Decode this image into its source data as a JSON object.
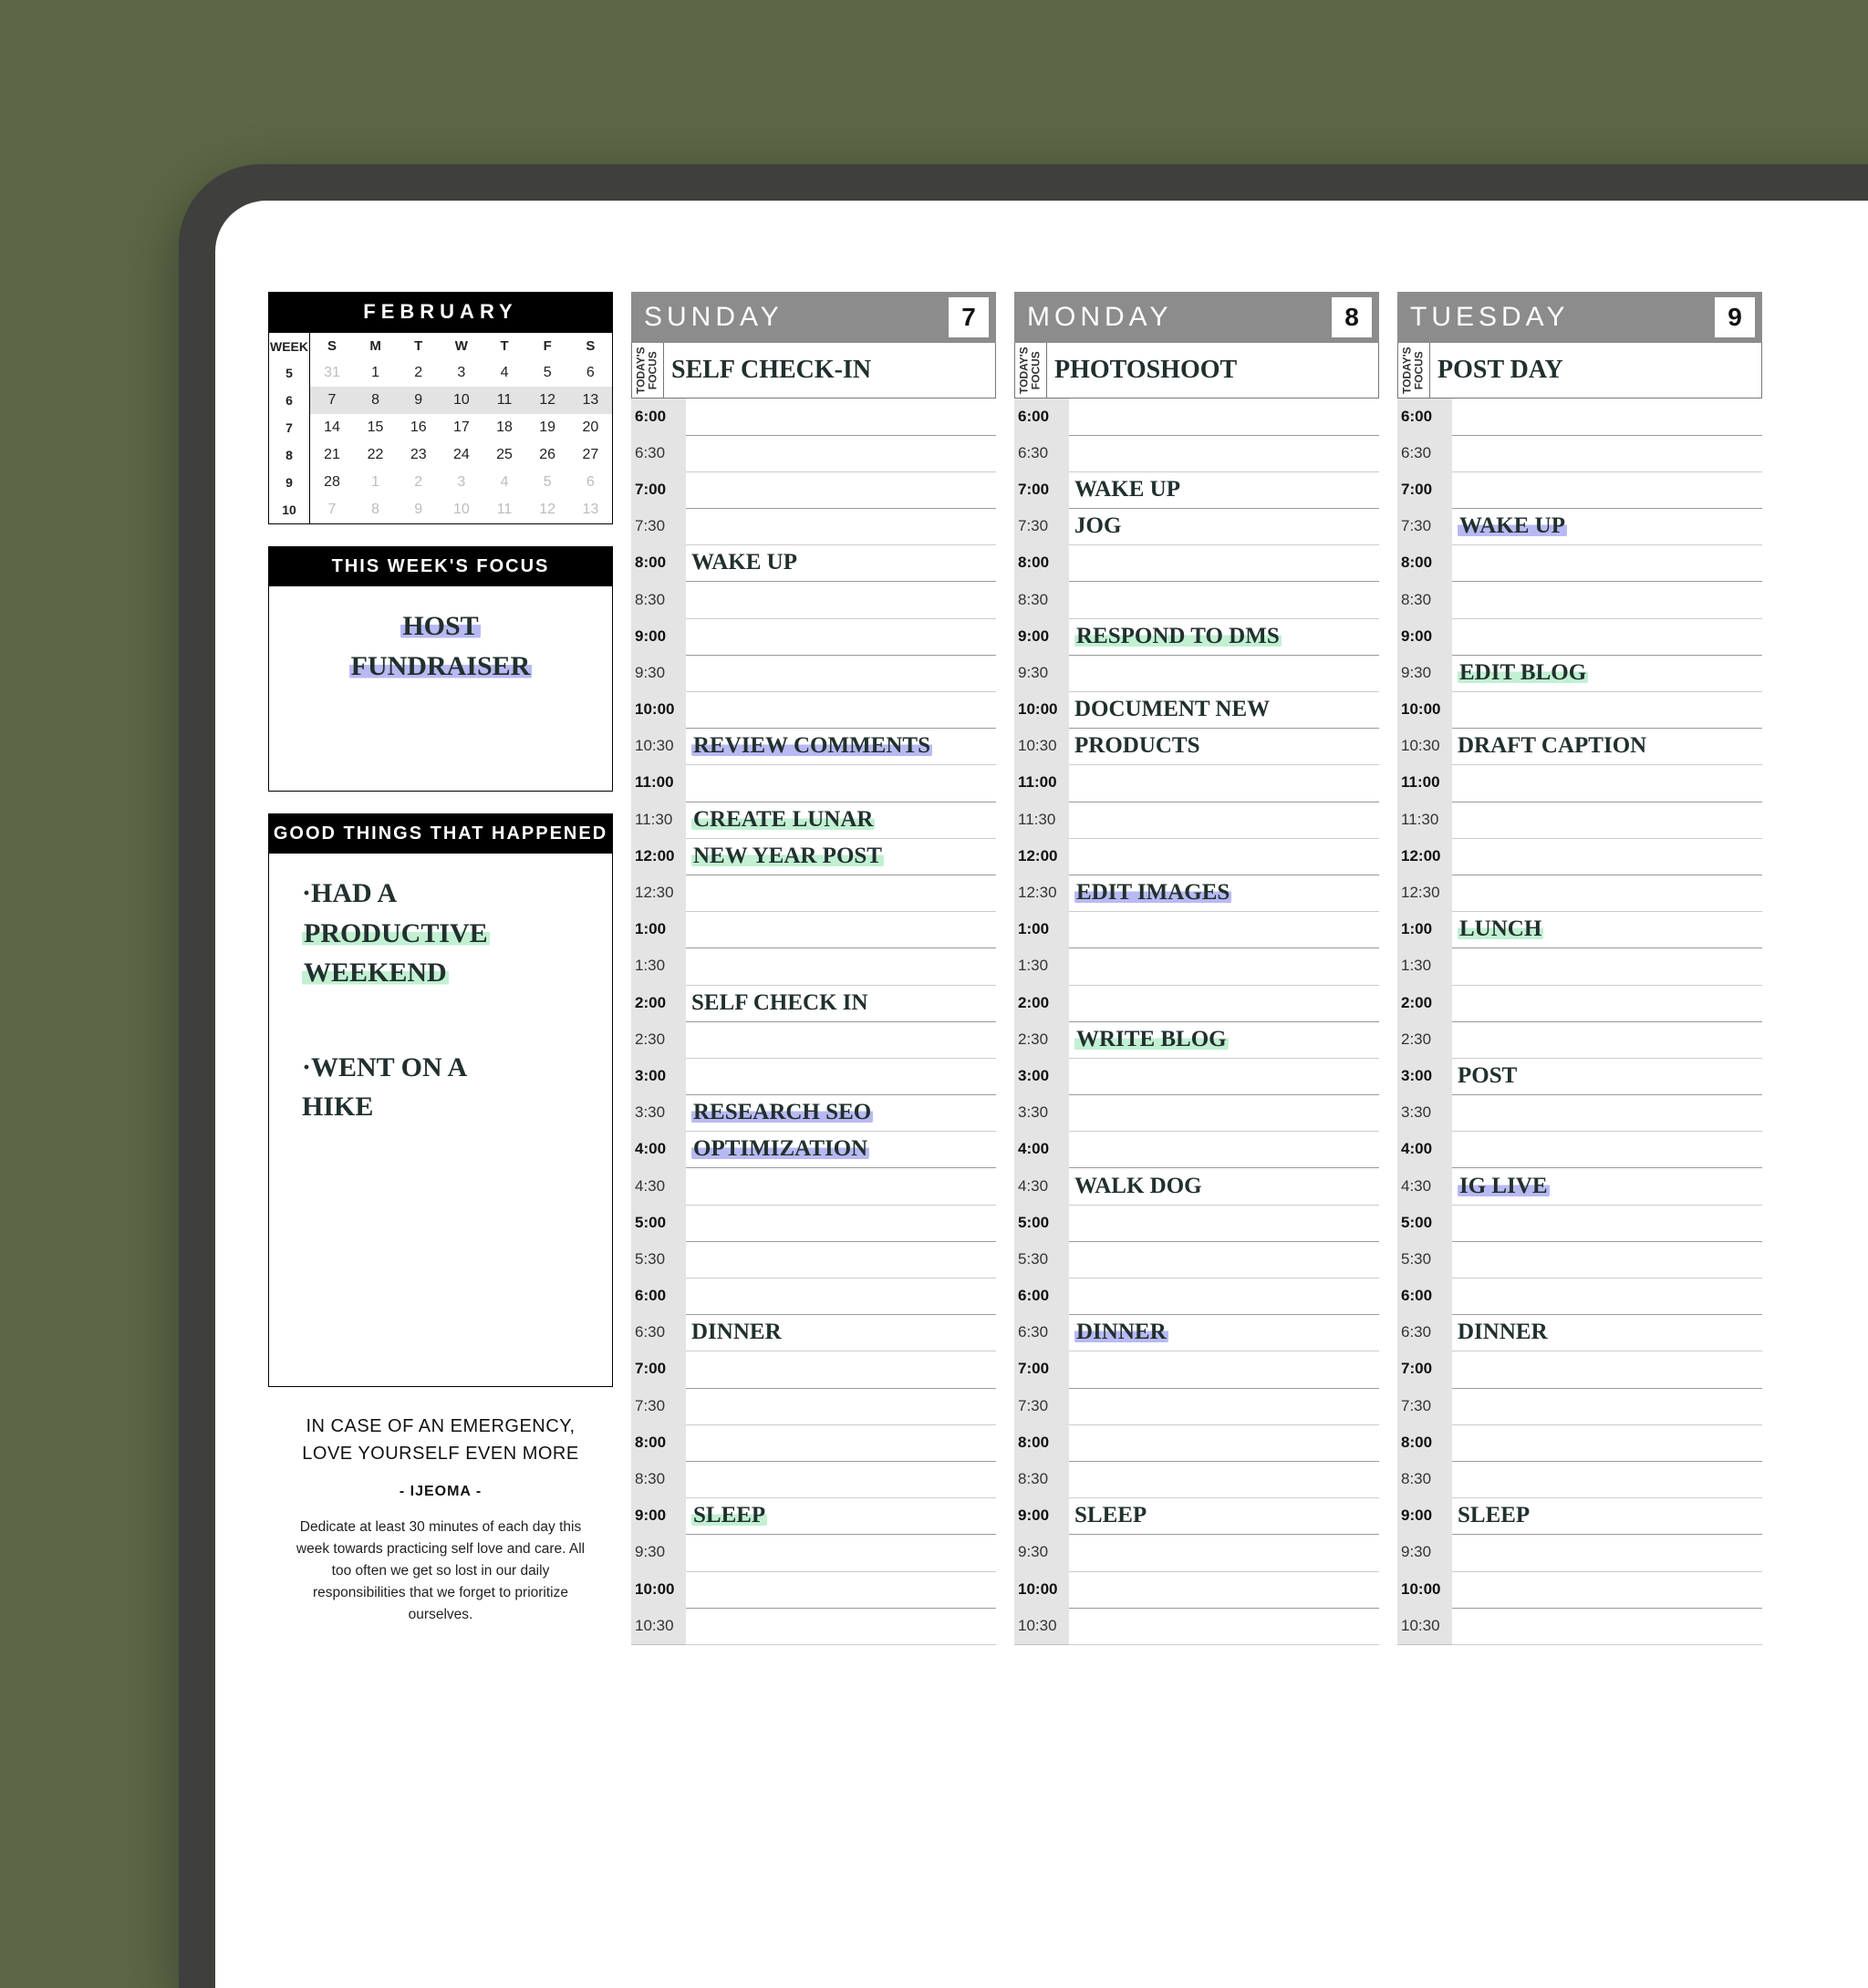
{
  "minical": {
    "title": "FEBRUARY",
    "headers": [
      "WEEK",
      "S",
      "M",
      "T",
      "W",
      "T",
      "F",
      "S"
    ],
    "rows": [
      {
        "week": "5",
        "cells": [
          {
            "v": "31",
            "dim": true
          },
          {
            "v": "1"
          },
          {
            "v": "2"
          },
          {
            "v": "3"
          },
          {
            "v": "4"
          },
          {
            "v": "5"
          },
          {
            "v": "6"
          }
        ]
      },
      {
        "week": "6",
        "hl": true,
        "cells": [
          {
            "v": "7"
          },
          {
            "v": "8"
          },
          {
            "v": "9"
          },
          {
            "v": "10"
          },
          {
            "v": "11"
          },
          {
            "v": "12"
          },
          {
            "v": "13"
          }
        ]
      },
      {
        "week": "7",
        "cells": [
          {
            "v": "14"
          },
          {
            "v": "15"
          },
          {
            "v": "16"
          },
          {
            "v": "17"
          },
          {
            "v": "18"
          },
          {
            "v": "19"
          },
          {
            "v": "20"
          }
        ]
      },
      {
        "week": "8",
        "cells": [
          {
            "v": "21"
          },
          {
            "v": "22"
          },
          {
            "v": "23"
          },
          {
            "v": "24"
          },
          {
            "v": "25"
          },
          {
            "v": "26"
          },
          {
            "v": "27"
          }
        ]
      },
      {
        "week": "9",
        "cells": [
          {
            "v": "28"
          },
          {
            "v": "1",
            "dim": true
          },
          {
            "v": "2",
            "dim": true
          },
          {
            "v": "3",
            "dim": true
          },
          {
            "v": "4",
            "dim": true
          },
          {
            "v": "5",
            "dim": true
          },
          {
            "v": "6",
            "dim": true
          }
        ]
      },
      {
        "week": "10",
        "cells": [
          {
            "v": "7",
            "dim": true
          },
          {
            "v": "8",
            "dim": true
          },
          {
            "v": "9",
            "dim": true
          },
          {
            "v": "10",
            "dim": true
          },
          {
            "v": "11",
            "dim": true
          },
          {
            "v": "12",
            "dim": true
          },
          {
            "v": "13",
            "dim": true
          }
        ]
      }
    ]
  },
  "week_focus": {
    "title": "THIS WEEK'S FOCUS",
    "lines": [
      {
        "text": "Host",
        "hl": "purple"
      },
      {
        "text": "Fundraiser",
        "hl": "purple"
      }
    ]
  },
  "good_things": {
    "title": "GOOD THINGS THAT HAPPENED",
    "items": [
      {
        "parts": [
          {
            "text": "·Had a"
          },
          {
            "text": "productive",
            "hl": "green"
          },
          {
            "text": "weekend",
            "hl": "green"
          }
        ]
      },
      {
        "parts": [
          {
            "text": "·Went on a"
          },
          {
            "text": "hike"
          }
        ]
      }
    ]
  },
  "quote": {
    "main_l1": "IN CASE OF AN EMERGENCY,",
    "main_l2": "LOVE YOURSELF EVEN MORE",
    "author": "- IJEOMA -",
    "sub": "Dedicate at least 30 minutes of each day this week towards practicing self love and care. All too often we get so lost in our daily responsibilities that we forget to prioritize ourselves."
  },
  "focus_label": "TODAY'S\nFOCUS",
  "times": [
    "6:00",
    "6:30",
    "7:00",
    "7:30",
    "8:00",
    "8:30",
    "9:00",
    "9:30",
    "10:00",
    "10:30",
    "11:00",
    "11:30",
    "12:00",
    "12:30",
    "1:00",
    "1:30",
    "2:00",
    "2:30",
    "3:00",
    "3:30",
    "4:00",
    "4:30",
    "5:00",
    "5:30",
    "6:00",
    "6:30",
    "7:00",
    "7:30",
    "8:00",
    "8:30",
    "9:00",
    "9:30",
    "10:00",
    "10:30"
  ],
  "days": [
    {
      "name": "SUNDAY",
      "num": "7",
      "focus": "Self check-in",
      "entries": {
        "8:00": {
          "t": "Wake up"
        },
        "10:30": {
          "t": "Review comments",
          "hl": "purple"
        },
        "11:30": {
          "t": "Create lunar",
          "hl": "green"
        },
        "12:00": {
          "t": "new year post",
          "hl": "green"
        },
        "2:00": {
          "t": "Self check in"
        },
        "3:30": {
          "t": "Research SEO",
          "hl": "purple"
        },
        "4:00": {
          "t": "optimization",
          "hl": "purple"
        },
        "6:30b": {
          "t": "Dinner"
        },
        "9:00b": {
          "t": "Sleep",
          "hl": "green"
        }
      }
    },
    {
      "name": "MONDAY",
      "num": "8",
      "focus": "Photoshoot",
      "entries": {
        "7:00": {
          "t": "Wake up"
        },
        "7:30": {
          "t": "Jog"
        },
        "9:00": {
          "t": "Respond to DMs",
          "hl": "green"
        },
        "10:00": {
          "t": "Document new"
        },
        "10:30": {
          "t": "products"
        },
        "12:30": {
          "t": "Edit images",
          "hl": "purple"
        },
        "2:30": {
          "t": "Write blog",
          "hl": "green"
        },
        "4:30": {
          "t": "Walk dog"
        },
        "6:30b": {
          "t": "Dinner",
          "hl": "purple"
        },
        "9:00b": {
          "t": "Sleep"
        }
      }
    },
    {
      "name": "TUESDAY",
      "num": "9",
      "focus": "Post day",
      "entries": {
        "7:30": {
          "t": "Wake up",
          "hl": "purple"
        },
        "9:30": {
          "t": "Edit blog",
          "hl": "green"
        },
        "10:30": {
          "t": "Draft caption"
        },
        "1:00": {
          "t": "Lunch",
          "hl": "green"
        },
        "3:00": {
          "t": "Post"
        },
        "4:30": {
          "t": "IG Live",
          "hl": "purple"
        },
        "6:30b": {
          "t": "Dinner"
        },
        "9:00b": {
          "t": "Sleep"
        }
      }
    }
  ]
}
